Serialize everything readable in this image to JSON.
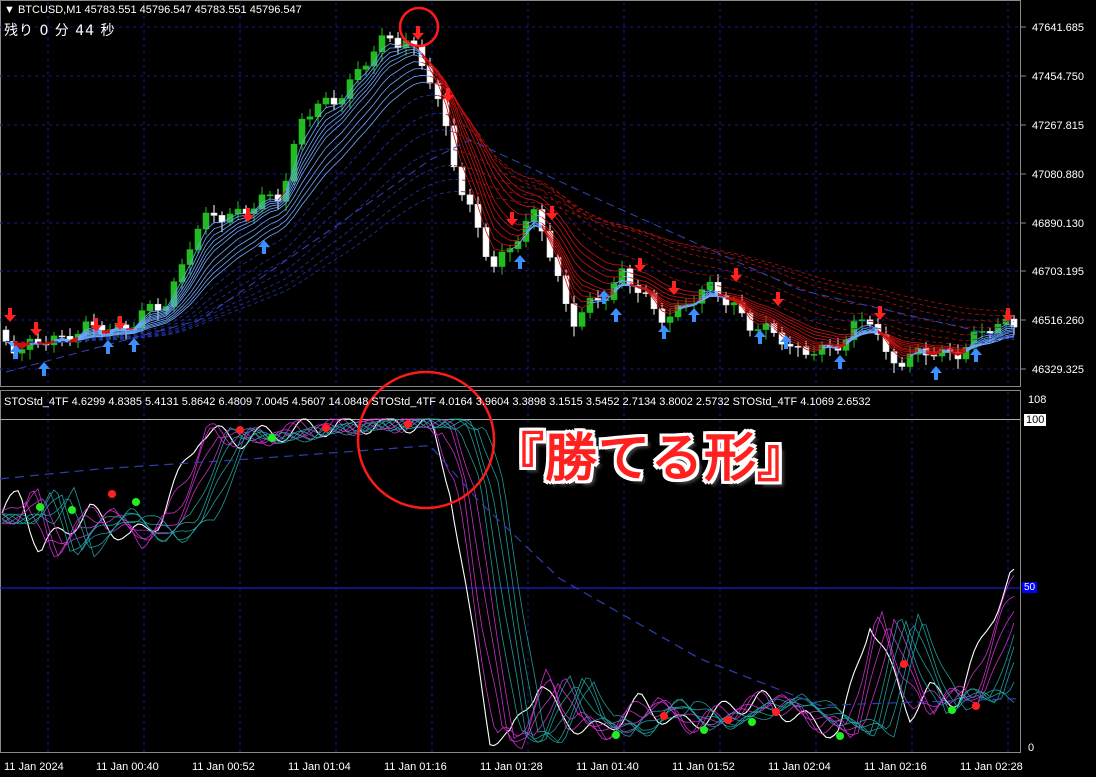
{
  "main_header": {
    "symbol": "▼ BTCUSD,M1  45783.551 45796.547 45783.551 45796.547"
  },
  "timer": {
    "text": "残り 0 分 44 秒"
  },
  "price_axis": [
    "47641.685",
    "47454.750",
    "47267.815",
    "47080.880",
    "46890.130",
    "46703.195",
    "46516.260",
    "46329.325"
  ],
  "time_axis": [
    "11 Jan 2024",
    "11 Jan 00:40",
    "11 Jan 00:52",
    "11 Jan 01:04",
    "11 Jan 01:16",
    "11 Jan 01:28",
    "11 Jan 01:40",
    "11 Jan 01:52",
    "11 Jan 02:04",
    "11 Jan 02:16",
    "11 Jan 02:28"
  ],
  "sub_header": {
    "text": "STOStd_4TF 4.6299 4.8385 5.4131 5.8642 6.4809 7.0045 4.5607 14.0848  STOStd_4TF 4.0164 3.9604 3.3898 3.1515 3.5452 2.7134 3.8002 2.5732  STOStd_4TF 4.1069 2.6532"
  },
  "sub_axis": {
    "top": "108",
    "max": "100",
    "mid": "50",
    "min": "0"
  },
  "annotation": {
    "text": "『勝てる形』"
  },
  "colors": {
    "bull": "#22bb22",
    "bear": "#ffffff",
    "up_ribbon": "#6fa8ff",
    "down_ribbon": "#cc1111",
    "sto_magenta": "#dd33dd",
    "sto_teal": "#22aaaa",
    "grid": "#1a1a8a"
  }
}
